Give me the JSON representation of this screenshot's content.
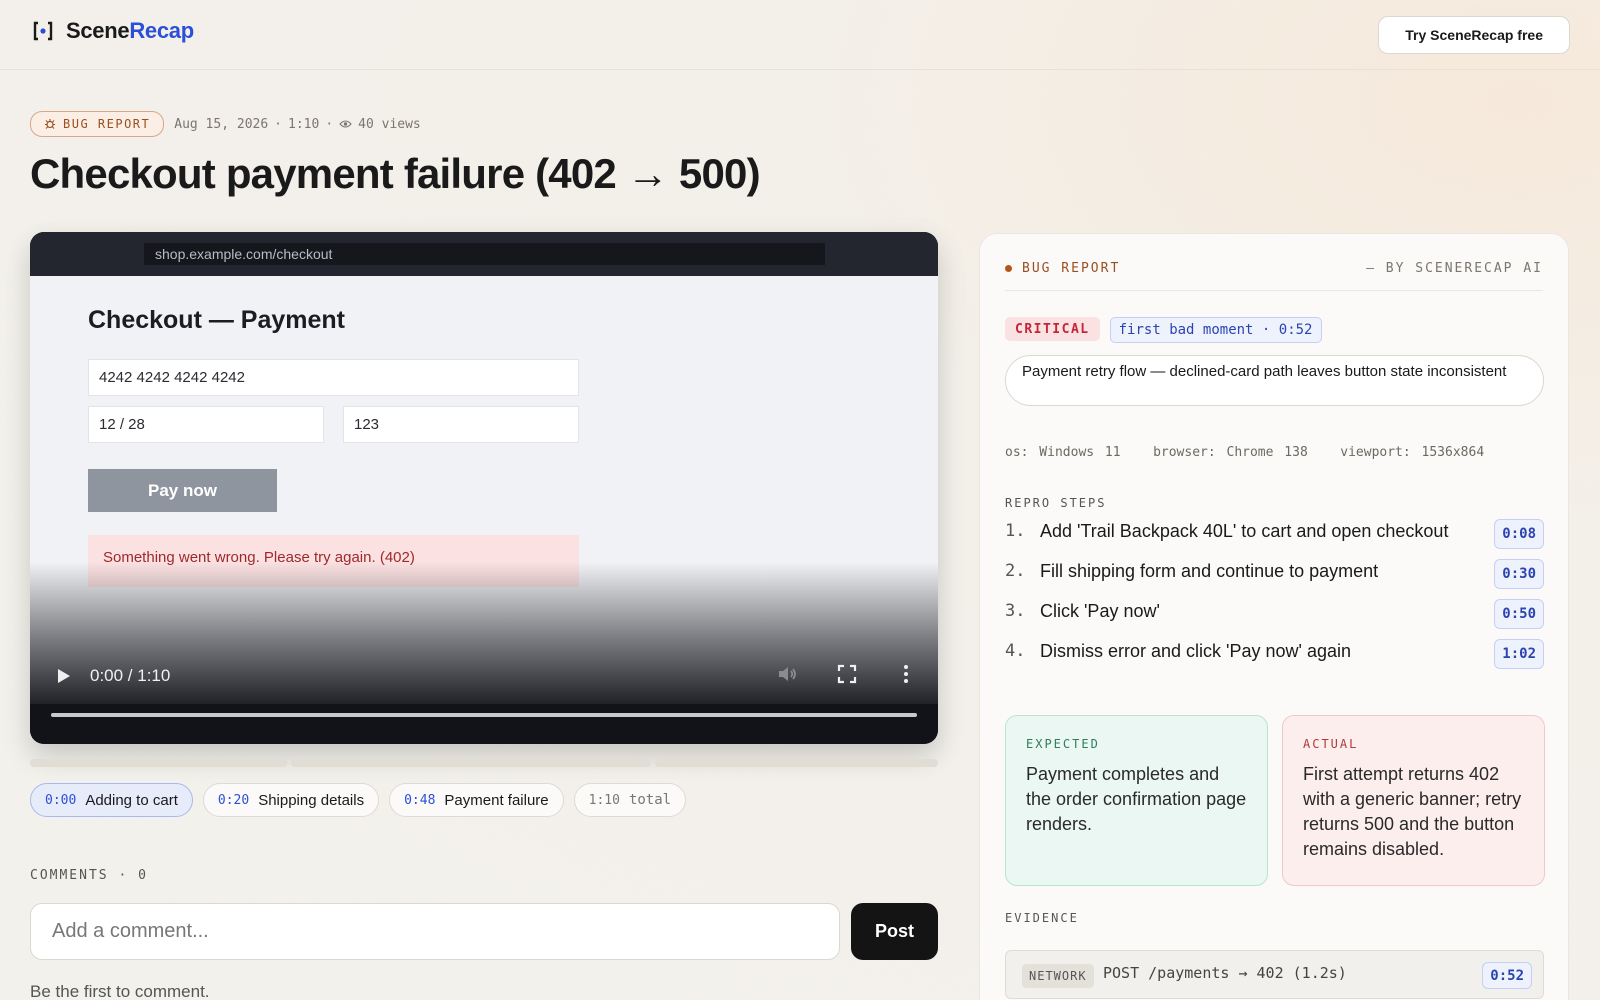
{
  "brand": {
    "name_part1": "Scene",
    "name_part2": "Recap"
  },
  "header": {
    "try_button": "Try SceneRecap free"
  },
  "meta": {
    "tag": "BUG REPORT",
    "date": "Aug 15, 2026",
    "duration": "1:10",
    "views": "40 views"
  },
  "title": "Checkout payment failure (402 → 500)",
  "video": {
    "url": "shop.example.com/checkout",
    "checkout_title": "Checkout — Payment",
    "card_number": "4242 4242 4242 4242",
    "expiry": "12 / 28",
    "cvc": "123",
    "pay_button": "Pay now",
    "error_text": "Something went wrong. Please try again. (402)",
    "time_display": "0:00 / 1:10",
    "progress": 0
  },
  "chapters": [
    {
      "ts": "0:00",
      "label": "Adding to cart",
      "active": true
    },
    {
      "ts": "0:20",
      "label": "Shipping details",
      "active": false
    },
    {
      "ts": "0:48",
      "label": "Payment failure",
      "active": false
    }
  ],
  "total": {
    "ts": "1:10",
    "label": "total"
  },
  "comments": {
    "label": "COMMENTS · 0",
    "placeholder": "Add a comment...",
    "post_button": "Post",
    "empty_text": "Be the first to comment."
  },
  "report": {
    "label": "BUG REPORT",
    "by": "— BY SCENERECAP AI",
    "severity": "CRITICAL",
    "first_bad_moment": "first bad moment · 0:52",
    "summary": "Payment retry flow — declined-card path leaves button state inconsistent",
    "env": {
      "os": "os: Windows 11",
      "browser": "browser: Chrome 138",
      "viewport": "viewport: 1536x864"
    },
    "steps_label": "REPRO STEPS",
    "steps": [
      {
        "num": "1.",
        "text": "Add 'Trail Backpack 40L' to cart and open checkout",
        "ts": "0:08"
      },
      {
        "num": "2.",
        "text": "Fill shipping form and continue to payment",
        "ts": "0:30"
      },
      {
        "num": "3.",
        "text": "Click 'Pay now'",
        "ts": "0:50"
      },
      {
        "num": "4.",
        "text": "Dismiss error and click 'Pay now' again",
        "ts": "1:02"
      }
    ],
    "expected_label": "EXPECTED",
    "expected": "Payment completes and the order confirmation page renders.",
    "actual_label": "ACTUAL",
    "actual": "First attempt returns 402 with a generic banner; retry returns 500 and the button remains disabled.",
    "evidence_label": "EVIDENCE",
    "evidence": {
      "tag": "NETWORK",
      "text": "POST /payments → 402 (1.2s)",
      "ts": "0:52"
    }
  },
  "colors": {
    "accent": "#2c4fd8",
    "critical": "#c2263b",
    "bug_tag": "#9a4f21",
    "expected_bg": "#eaf7f2",
    "actual_bg": "#fdeeee"
  },
  "icons": {
    "brand": "bracket-logo-icon",
    "bug": "bug-icon",
    "views": "eye-icon",
    "play": "play-icon",
    "mute": "volume-icon",
    "fullscreen": "fullscreen-icon",
    "more": "more-vertical-icon"
  }
}
